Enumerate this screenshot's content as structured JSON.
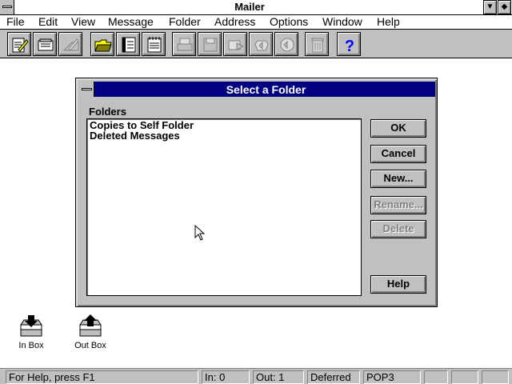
{
  "window": {
    "title": "Mailer"
  },
  "menu": [
    "File",
    "Edit",
    "View",
    "Message",
    "Folder",
    "Address",
    "Options",
    "Window",
    "Help"
  ],
  "toolbar": {
    "buttons": [
      "compose-icon",
      "read-mail-icon",
      "sign-icon",
      "open-folder-icon",
      "address-book-icon",
      "notepad-icon",
      "print-icon",
      "save-icon",
      "forward-icon",
      "reply-icon",
      "reply-all-icon",
      "trash-icon",
      "help-icon"
    ]
  },
  "dialog": {
    "title": "Select a Folder",
    "folders_label": "Folders",
    "folders": [
      "Copies to Self Folder",
      "Deleted Messages"
    ],
    "buttons": {
      "ok": "OK",
      "cancel": "Cancel",
      "new": "New...",
      "rename": "Rename...",
      "delete": "Delete",
      "help": "Help"
    }
  },
  "desktop_icons": {
    "inbox": "In Box",
    "outbox": "Out Box"
  },
  "status": {
    "help": "For Help, press F1",
    "in": "In: 0",
    "out": "Out: 1",
    "mode": "Deferred",
    "protocol": "POP3"
  },
  "colors": {
    "dialog_title": "#000080",
    "face": "#c0c0c0"
  }
}
